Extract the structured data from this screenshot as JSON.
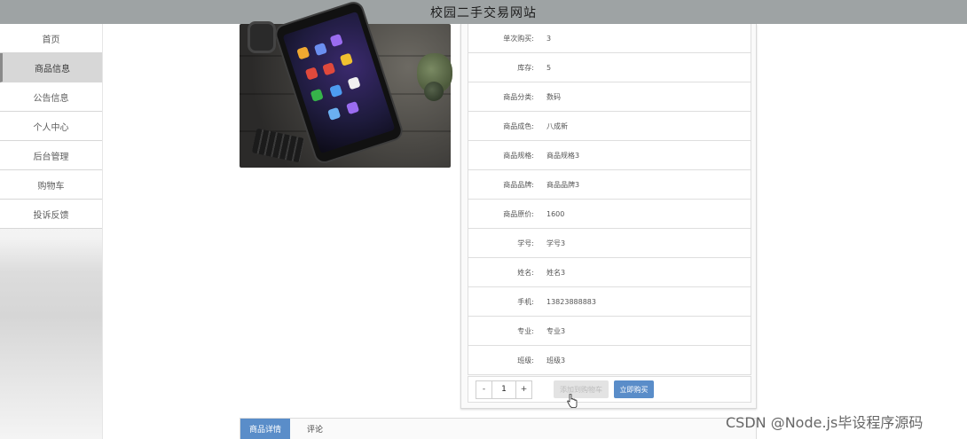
{
  "header": {
    "title": "校园二手交易网站"
  },
  "sidebar": {
    "items": [
      {
        "label": "首页"
      },
      {
        "label": "商品信息"
      },
      {
        "label": "公告信息"
      },
      {
        "label": "个人中心"
      },
      {
        "label": "后台管理"
      },
      {
        "label": "购物车"
      },
      {
        "label": "投诉反馈"
      }
    ],
    "active_index": 1
  },
  "product": {
    "details": [
      {
        "label": "单次购买:",
        "value": "3"
      },
      {
        "label": "库存:",
        "value": "5"
      },
      {
        "label": "商品分类:",
        "value": "数码"
      },
      {
        "label": "商品成色:",
        "value": "八成新"
      },
      {
        "label": "商品规格:",
        "value": "商品规格3"
      },
      {
        "label": "商品品牌:",
        "value": "商品品牌3"
      },
      {
        "label": "商品原价:",
        "value": "1600"
      },
      {
        "label": "学号:",
        "value": "学号3"
      },
      {
        "label": "姓名:",
        "value": "姓名3"
      },
      {
        "label": "手机:",
        "value": "13823888883"
      },
      {
        "label": "专业:",
        "value": "专业3"
      },
      {
        "label": "班级:",
        "value": "班级3"
      }
    ],
    "quantity": {
      "minus_label": "-",
      "value": "1",
      "plus_label": "+"
    },
    "add_to_cart_label": "添加到购物车",
    "buy_now_label": "立即购买"
  },
  "tabs": [
    {
      "label": "商品详情",
      "active": true
    },
    {
      "label": "评论",
      "active": false
    }
  ],
  "watermark": {
    "text": "CSDN @Node.js毕设程序源码"
  },
  "colors": {
    "header_bg": "#9ea3a4",
    "accent": "#5a8dc9",
    "sidebar_active_bg": "#d7d7d7"
  }
}
